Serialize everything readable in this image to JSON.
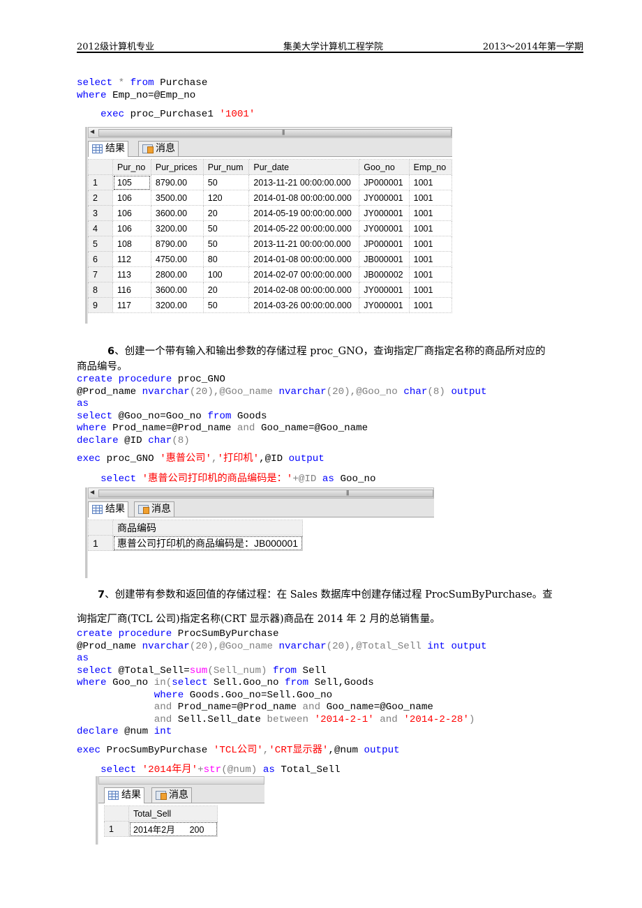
{
  "header": {
    "left": "2012级计算机专业",
    "center": "集美大学计算机工程学院",
    "right": "2013～2014年第一学期"
  },
  "code1": {
    "line1": {
      "kw1": "select",
      "op": " * ",
      "kw2": "from",
      "rest": " Purchase"
    },
    "line2": {
      "kw": "where",
      "rest": " Emp_no=@Emp_no"
    },
    "line3": {
      "kw": "exec",
      "rest": " proc_Purchase1 ",
      "str": "'1001'"
    }
  },
  "result1": {
    "tabs": [
      {
        "label": "结果",
        "icon": "grid-icon"
      },
      {
        "label": "消息",
        "icon": "messages-icon"
      }
    ],
    "columns": [
      "Pur_no",
      "Pur_prices",
      "Pur_num",
      "Pur_date",
      "Goo_no",
      "Emp_no"
    ],
    "rows": [
      {
        "n": "1",
        "cells": [
          "105",
          "8790.00",
          "50",
          "2013-11-21 00:00:00.000",
          "JP000001",
          "1001"
        ]
      },
      {
        "n": "2",
        "cells": [
          "106",
          "3500.00",
          "120",
          "2014-01-08 00:00:00.000",
          "JY000001",
          "1001"
        ]
      },
      {
        "n": "3",
        "cells": [
          "106",
          "3600.00",
          "20",
          "2014-05-19 00:00:00.000",
          "JY000001",
          "1001"
        ]
      },
      {
        "n": "4",
        "cells": [
          "106",
          "3200.00",
          "50",
          "2014-05-22 00:00:00.000",
          "JY000001",
          "1001"
        ]
      },
      {
        "n": "5",
        "cells": [
          "108",
          "8790.00",
          "50",
          "2013-11-21 00:00:00.000",
          "JP000001",
          "1001"
        ]
      },
      {
        "n": "6",
        "cells": [
          "112",
          "4750.00",
          "80",
          "2014-01-08 00:00:00.000",
          "JB000001",
          "1001"
        ]
      },
      {
        "n": "7",
        "cells": [
          "113",
          "2800.00",
          "100",
          "2014-02-07 00:00:00.000",
          "JB000002",
          "1001"
        ]
      },
      {
        "n": "8",
        "cells": [
          "116",
          "3600.00",
          "20",
          "2014-02-08 00:00:00.000",
          "JY000001",
          "1001"
        ]
      },
      {
        "n": "9",
        "cells": [
          "117",
          "3200.00",
          "50",
          "2014-03-26 00:00:00.000",
          "JY000001",
          "1001"
        ]
      }
    ]
  },
  "section6": {
    "number": "6",
    "line1": "、创建一个带有输入和输出参数的存储过程 proc_GNO，查询指定厂商指定名称的商品所对应的",
    "line2": "商品编号。"
  },
  "code2": {
    "l1": {
      "kw": "create procedure",
      "rest": " proc_GNO"
    },
    "l2": {
      "a": "@Prod_name ",
      "t1": "nvarchar",
      "b": "(20),@Goo_name ",
      "t2": "nvarchar",
      "c": "(20),@Goo_no ",
      "t3": "char",
      "d": "(8) ",
      "kw": "output"
    },
    "l3": {
      "kw": "as"
    },
    "l4": {
      "kw1": "select",
      "a": " @Goo_no=Goo_no ",
      "kw2": "from",
      "b": " Goods"
    },
    "l5": {
      "kw": "where",
      "a": " Prod_name=@Prod_name ",
      "op": "and",
      "b": " Goo_name=@Goo_name"
    },
    "l6": {
      "kw": "declare",
      "a": " @ID ",
      "t": "char",
      "b": "(8)"
    },
    "l7": {
      "kw": "exec",
      "a": " proc_GNO ",
      "s1": "'惠普公司'",
      "c": ",",
      "s2": "'打印机'",
      "d": ",@ID ",
      "kw2": "output"
    },
    "l8": {
      "kw": "select",
      "sp": " ",
      "s": "'惠普公司打印机的商品编码是：'",
      "a": "+@ID ",
      "kw2": "as",
      "b": " Goo_no"
    }
  },
  "result2": {
    "tabs": [
      {
        "label": "结果",
        "icon": "grid-icon"
      },
      {
        "label": "消息",
        "icon": "messages-icon"
      }
    ],
    "columns": [
      "商品编码"
    ],
    "rows": [
      {
        "n": "1",
        "cells": [
          "惠普公司打印机的商品编码是：JB000001"
        ]
      }
    ]
  },
  "section7": {
    "number": "7",
    "line1": "、创建带有参数和返回值的存储过程：在 Sales 数据库中创建存储过程 ProcSumByPurchase。查",
    "line2": "询指定厂商(TCL 公司)指定名称(CRT 显示器)商品在 2014 年 2 月的总销售量。"
  },
  "code3": {
    "l1": {
      "kw": "create procedure",
      "rest": " ProcSumByPurchase"
    },
    "l2": {
      "a": "@Prod_name ",
      "t1": "nvarchar",
      "b": "(20),@Goo_name ",
      "t2": "nvarchar",
      "c": "(20),@Total_Sell ",
      "t3": "int",
      "sp": " ",
      "kw": "output"
    },
    "l3": {
      "kw": "as"
    },
    "l4": {
      "kw1": "select",
      "a": " @Total_Sell=",
      "fn": "sum",
      "b": "(Sell_num) ",
      "kw2": "from",
      "c": " Sell"
    },
    "l5": {
      "kw1": "where",
      "a": " Goo_no ",
      "op": "in",
      "b": "(",
      "kw2": "select",
      "c": " Sell.Goo_no ",
      "kw3": "from",
      "d": " Sell,Goods"
    },
    "l6": {
      "indent": "             ",
      "kw": "where",
      "a": " Goods.Goo_no=Sell.Goo_no"
    },
    "l7": {
      "indent": "             ",
      "op1": "and",
      "a": " Prod_name=@Prod_name ",
      "op2": "and",
      "b": " Goo_name=@Goo_name"
    },
    "l8": {
      "indent": "             ",
      "op1": "and",
      "a": " Sell.Sell_date ",
      "op2": "between",
      "sp": " ",
      "s1": "'2014-2-1'",
      "sp2": " ",
      "op3": "and",
      "sp3": " ",
      "s2": "'2014-2-28'",
      "b": ")"
    },
    "l9": {
      "kw": "declare",
      "a": " @num ",
      "t": "int"
    },
    "l10": {
      "kw": "exec",
      "a": " ProcSumByPurchase ",
      "s1": "'TCL公司'",
      "c": ",",
      "s2": "'CRT显示器'",
      "d": ",@num ",
      "kw2": "output"
    },
    "l11": {
      "kw": "select",
      "sp": " ",
      "s": "'2014年月'",
      "a": "+",
      "fn": "str",
      "b": "(@num) ",
      "kw2": "as",
      "c": " Total_Sell"
    }
  },
  "result3": {
    "tabs": [
      {
        "label": "结果",
        "icon": "grid-icon"
      },
      {
        "label": "消息",
        "icon": "messages-icon"
      }
    ],
    "columns": [
      "Total_Sell"
    ],
    "rows": [
      {
        "n": "1",
        "cells": [
          "2014年2月      200"
        ]
      }
    ]
  }
}
